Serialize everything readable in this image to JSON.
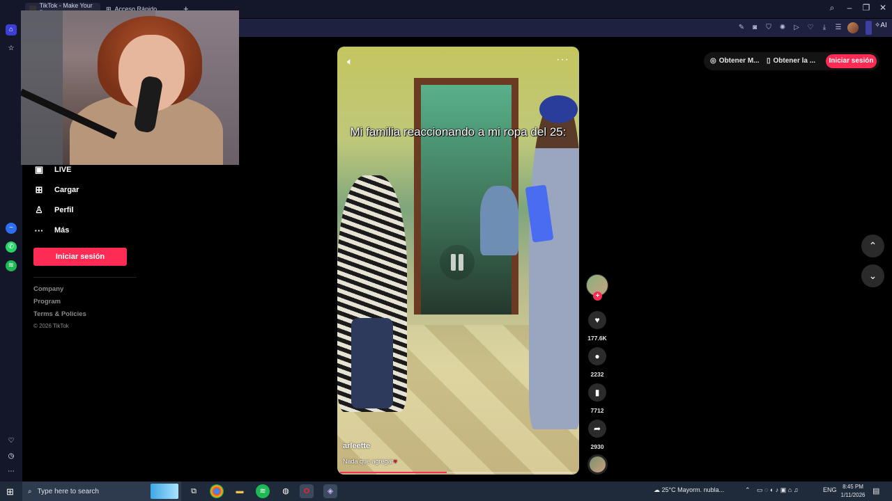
{
  "browser": {
    "tabs": [
      {
        "label": "TikTok - Make Your D"
      },
      {
        "label": "Acceso Rápido"
      }
    ],
    "new_tab_icon": "plus-icon",
    "ai_label": "AI"
  },
  "sidebar": {
    "items": [
      {
        "label": "LIVE",
        "icon": "live-icon"
      },
      {
        "label": "Cargar",
        "icon": "upload-icon"
      },
      {
        "label": "Perfil",
        "icon": "profile-icon"
      },
      {
        "label": "Más",
        "icon": "more-icon"
      }
    ],
    "login_label": "Iniciar sesión",
    "footer_links": [
      "Company",
      "Program",
      "Terms & Policies"
    ],
    "copyright": "© 2026 TikTok"
  },
  "video": {
    "caption": "Mi familia reaccionando a mi ropa del 25:",
    "author": "arleette",
    "description": "Nada que agregar",
    "description_emoji": "♥",
    "progress": 0.45
  },
  "actions": {
    "likes": "177.6K",
    "comments": "2232",
    "saves": "7712",
    "shares": "2930"
  },
  "top_bar": {
    "get_app_label": "Obtener M...",
    "get_app2_label": "Obtener la ...",
    "login_label": "Iniciar sesión"
  },
  "taskbar": {
    "search_placeholder": "Type here to search",
    "weather": "25°C  Mayorm. nubla...",
    "language": "ENG",
    "time": "8:45 PM",
    "date": "1/11/2026"
  },
  "colors": {
    "brand": "#fe2c55",
    "browser_bg": "#14162a"
  }
}
